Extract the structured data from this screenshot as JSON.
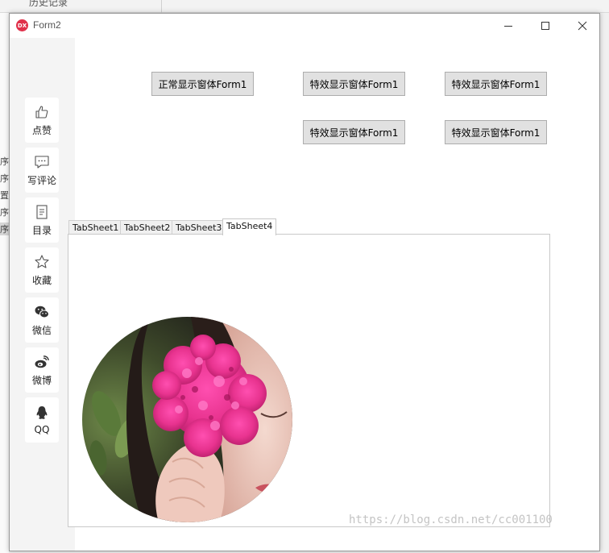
{
  "background_app": {
    "top_item": "历史记录",
    "left_chars": [
      "序",
      "序",
      "置",
      "序",
      "序"
    ]
  },
  "window": {
    "title": "Form2",
    "icon_text": "DX",
    "controls": {
      "minimize": "—",
      "maximize": "☐",
      "close": "✕"
    }
  },
  "sidebar": {
    "items": [
      {
        "label": "点赞",
        "icon": "thumbs-up-icon"
      },
      {
        "label": "写评论",
        "icon": "comment-icon"
      },
      {
        "label": "目录",
        "icon": "document-icon"
      },
      {
        "label": "收藏",
        "icon": "star-icon"
      },
      {
        "label": "微信",
        "icon": "wechat-icon"
      },
      {
        "label": "微博",
        "icon": "weibo-icon"
      },
      {
        "label": "QQ",
        "icon": "qq-penguin-icon"
      }
    ]
  },
  "buttons": {
    "normal_show": "正常显示窗体Form1",
    "effect_show_1": "特效显示窗体Form1",
    "effect_show_2": "特效显示窗体Form1",
    "effect_show_3": "特效显示窗体Form1",
    "effect_show_4": "特效显示窗体Form1"
  },
  "tabs": {
    "items": [
      "TabSheet1",
      "TabSheet2",
      "TabSheet3",
      "TabSheet4"
    ],
    "active": "TabSheet4"
  },
  "colors": {
    "app_icon": "#e0304a",
    "flower": "#e8338f"
  },
  "watermark": "https://blog.csdn.net/cc001100"
}
